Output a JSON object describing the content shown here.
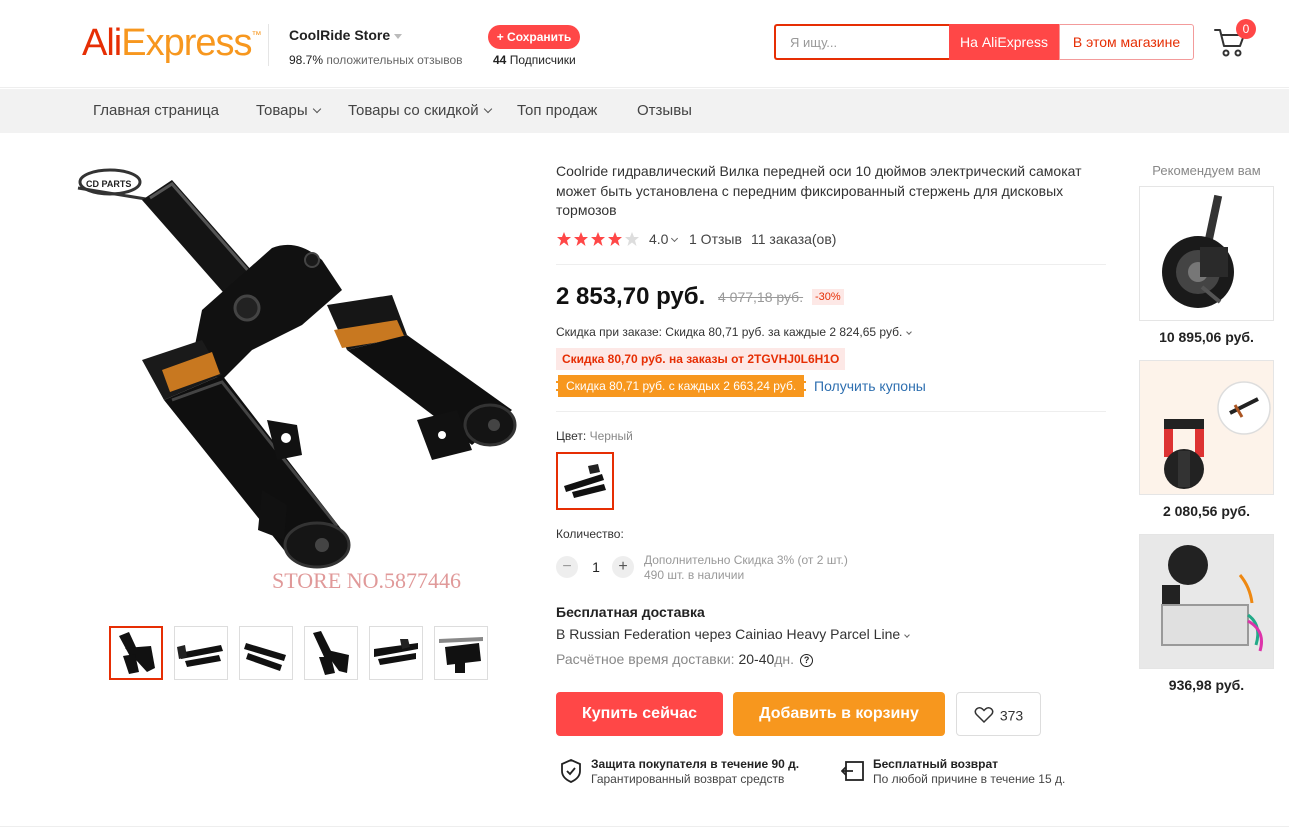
{
  "header": {
    "logo_ali": "Ali",
    "logo_express": "Express",
    "logo_tm": "™",
    "store_name": "CoolRide Store",
    "rating_percent": "98.7%",
    "rating_text": "положительных отзывов",
    "save_label": "+ Сохранить",
    "subscribers_count": "44",
    "subscribers_label": "Подписчики",
    "search_placeholder": "Я ищу...",
    "search_ali_label": "На AliExpress",
    "search_store_label": "В этом магазине",
    "cart_count": "0"
  },
  "nav": {
    "items": [
      {
        "label": "Главная страница"
      },
      {
        "label": "Товары"
      },
      {
        "label": "Товары со скидкой"
      },
      {
        "label": "Топ продаж"
      },
      {
        "label": "Отзывы"
      }
    ]
  },
  "gallery": {
    "watermark_store": "STORE NO.5877446",
    "watermark_brand": "CD PARTS",
    "thumbnail_count": 6
  },
  "product": {
    "title": "Coolride гидравлический Вилка передней оси 10 дюймов электрический самокат может быть установлена с передним фиксированный стержень для дисковых тормозов",
    "rating": "4.0",
    "rating_stars": 4.0,
    "reviews": "1 Отзыв",
    "orders": "11 заказа(ов)",
    "price": "2 853,70 руб.",
    "old_price": "4 077,18 руб.",
    "discount": "-30%",
    "order_discount": "Скидка при заказе: Скидка 80,71 руб. за каждые 2 824,65 руб.",
    "coupon_code_text": "Скидка 80,70 руб. на заказы от 2TGVHJ0L6H1O",
    "coupon_text": "Скидка 80,71 руб. с каждых 2 663,24 руб.",
    "get_coupons": "Получить купоны",
    "color_label": "Цвет:",
    "color_value": "Черный",
    "quantity_label": "Количество:",
    "quantity_value": "1",
    "quantity_minus": "−",
    "quantity_plus": "+",
    "extra_discount": "Дополнительно Скидка 3% (от 2 шт.)",
    "stock": "490 шт. в наличии",
    "shipping_title": "Бесплатная доставка",
    "shipping_route": "В Russian Federation через Cainiao Heavy Parcel Line",
    "delivery_label": "Расчётное время доставки:",
    "delivery_value": "20-40",
    "delivery_unit": "дн.",
    "buy_now": "Купить сейчас",
    "add_to_cart": "Добавить в корзину",
    "wishlist_count": "373",
    "protection_title": "Защита покупателя в течение 90 д.",
    "protection_sub": "Гарантированный возврат средств",
    "return_title": "Бесплатный возврат",
    "return_sub": "По любой причине в течение 15 д."
  },
  "recommend": {
    "title": "Рекомендуем вам",
    "items": [
      {
        "price": "10 895,06 руб."
      },
      {
        "price": "2 080,56 руб."
      },
      {
        "price": "936,98 руб."
      }
    ]
  },
  "colors": {
    "brand_red": "#ff4747",
    "brand_orange": "#f7971e",
    "star": "#ff4747"
  }
}
